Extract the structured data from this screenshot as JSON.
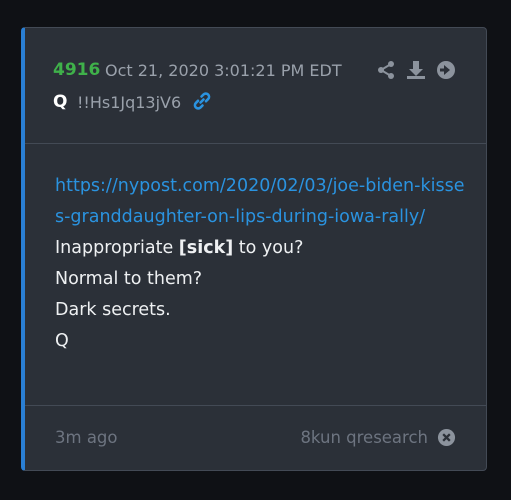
{
  "post": {
    "number": "4916",
    "timestamp": "Oct 21, 2020 3:01:21 PM EDT",
    "author": "Q",
    "tripcode": "!!Hs1Jq13jV6",
    "url": "https://nypost.com/2020/02/03/joe-biden-kisses-granddaughter-on-lips-during-iowa-rally/",
    "line1_pre": "Inappropriate ",
    "line1_bold": "[sick]",
    "line1_post": " to you?",
    "line2": "Normal to them?",
    "line3": "Dark secrets.",
    "line4": "Q"
  },
  "footer": {
    "ago": "3m ago",
    "source": "8kun qresearch"
  },
  "icons": {
    "share": "share-icon",
    "download": "download-icon",
    "forward": "arrow-right-circle-icon",
    "link": "link-icon",
    "close": "close-circle-icon"
  },
  "colors": {
    "accent": "#2a7fd4",
    "post_number": "#3fb14a",
    "link": "#2a93e0",
    "background": "#2b3038"
  }
}
